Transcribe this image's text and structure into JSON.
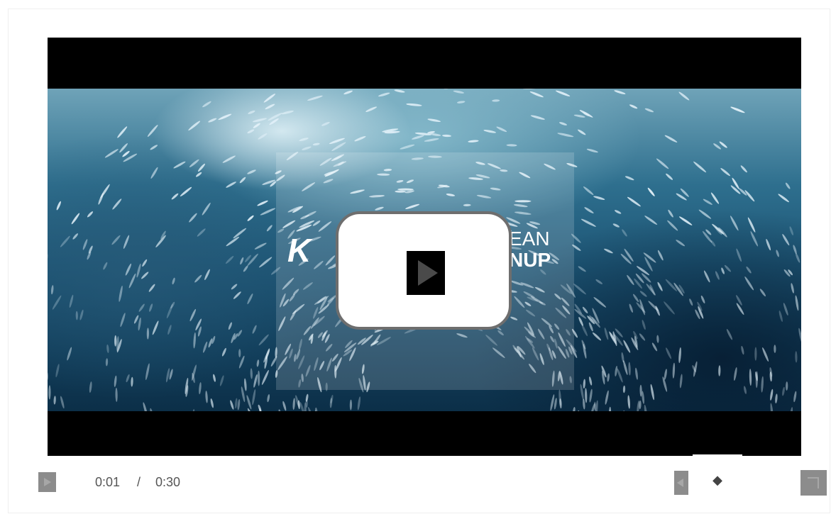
{
  "player": {
    "video_logo": {
      "brand_mark": "K",
      "line1": "EAN",
      "line2": "NUP"
    },
    "center_play_icon": "play-icon",
    "controls": {
      "play_icon": "play-icon",
      "current_time": "0:01",
      "separator": "/",
      "total_time": "0:30",
      "volume_icon": "volume-icon",
      "volume_handle_glyph": "◆",
      "fullscreen_icon": "fullscreen-icon"
    }
  },
  "colors": {
    "control_bg": "#8c8c8c",
    "time_text": "#555555",
    "play_overlay_border": "#6e6e6e",
    "video_letterbox": "#000000"
  }
}
